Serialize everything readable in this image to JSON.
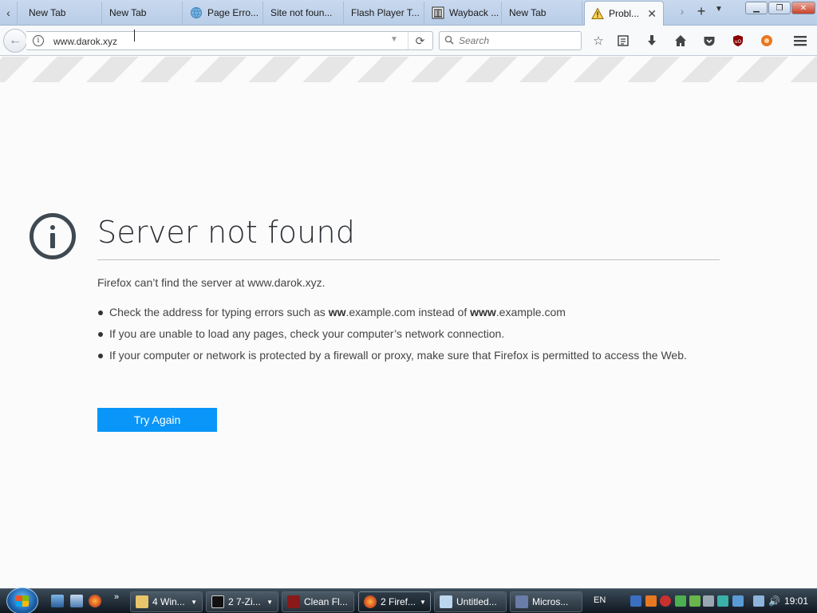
{
  "tabs": [
    {
      "label": "New Tab",
      "icon": "none"
    },
    {
      "label": "New Tab",
      "icon": "none"
    },
    {
      "label": "Page Erro...",
      "icon": "globe-icon"
    },
    {
      "label": "Site not foun...",
      "icon": "none"
    },
    {
      "label": "Flash Player T...",
      "icon": "none"
    },
    {
      "label": "Wayback ...",
      "icon": "archive-icon"
    },
    {
      "label": "New Tab",
      "icon": "none"
    },
    {
      "label": "Probl...",
      "icon": "warning-icon",
      "active": true
    }
  ],
  "navbar": {
    "url": "www.darok.xyz",
    "search_placeholder": "Search"
  },
  "error": {
    "title": "Server not found",
    "description": "Firefox can’t find the server at www.darok.xyz.",
    "suggestions": [
      {
        "pre": "Check the address for typing errors such as ",
        "b1": "ww",
        "mid": ".example.com instead of ",
        "b2": "www",
        "post": ".example.com"
      },
      {
        "text": "If you are unable to load any pages, check your computer’s network connection."
      },
      {
        "text": "If your computer or network is protected by a firewall or proxy, make sure that Firefox is permitted to access the Web."
      }
    ],
    "try_again_label": "Try Again"
  },
  "taskbar": {
    "buttons": [
      {
        "label": "4 Win...",
        "icon": "folder-icon"
      },
      {
        "label": "2 7-Zi...",
        "icon": "7zip-icon"
      },
      {
        "label": "Clean Fl...",
        "icon": "flash-icon"
      },
      {
        "label": "2 Firef...",
        "icon": "firefox-icon",
        "active": true
      },
      {
        "label": "Untitled...",
        "icon": "notepad-icon"
      },
      {
        "label": "Micros...",
        "icon": "app-icon"
      }
    ],
    "language": "EN",
    "clock": "19:01"
  },
  "colors": {
    "accent": "#0996f8",
    "title_text": "#2b2e33",
    "tab_strip": "#c9d9ee"
  }
}
